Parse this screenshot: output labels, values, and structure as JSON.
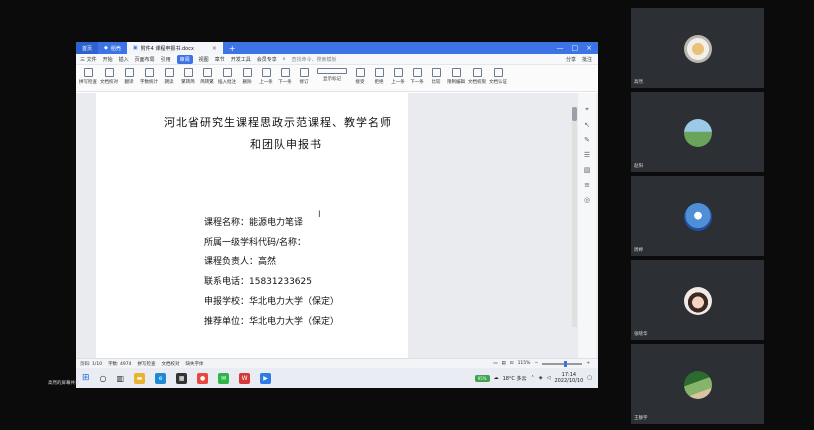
{
  "wps": {
    "tabs": [
      {
        "label": "首页"
      },
      {
        "label": "稻壳"
      },
      {
        "label": "附件4 课程申报书.docx"
      }
    ],
    "menu": [
      "三 文件",
      "开始",
      "插入",
      "页面布局",
      "引用",
      "审阅",
      "视图",
      "章节",
      "开发工具",
      "会员专享"
    ],
    "menu_selected_index": 5,
    "search_placeholder": "查找命令、搜索模板",
    "menu_right": [
      "分享",
      "批注"
    ],
    "ribbon": [
      "拼写检查",
      "文档校对",
      "翻译",
      "字数统计",
      "朗读",
      "繁转简",
      "简转繁",
      "插入批注",
      "删除",
      "上一条",
      "下一条",
      "修订",
      "显示标记",
      "接受",
      "拒绝",
      "上一条",
      "下一条",
      "比较",
      "限制编辑",
      "文档权限",
      "文档认证"
    ],
    "status": {
      "page": "页码: 1/10",
      "words": "字数: 4974",
      "spell": "拼写检查",
      "proof": "文档校对",
      "missing_font": "缺失字体",
      "zoom": "115%"
    }
  },
  "document": {
    "title_line1": "河北省研究生课程思政示范课程、教学名师",
    "title_line2": "和团队申报书",
    "fields": [
      "课程名称：能源电力笔译",
      "所属一级学科代码/名称：",
      "课程负责人：高然",
      "联系电话：15831233625",
      "申报学校：华北电力大学（保定）",
      "推荐单位：华北电力大学（保定）"
    ]
  },
  "taskbar": {
    "battery": "95%",
    "weather": "18°C 多云",
    "time": "17:14",
    "date": "2022/10/10"
  },
  "sharer": "高然的屏幕共享",
  "participants": [
    {
      "name": "高然"
    },
    {
      "name": "赵阳"
    },
    {
      "name": "周婷"
    },
    {
      "name": "张晓华"
    },
    {
      "name": "王静宇"
    }
  ]
}
